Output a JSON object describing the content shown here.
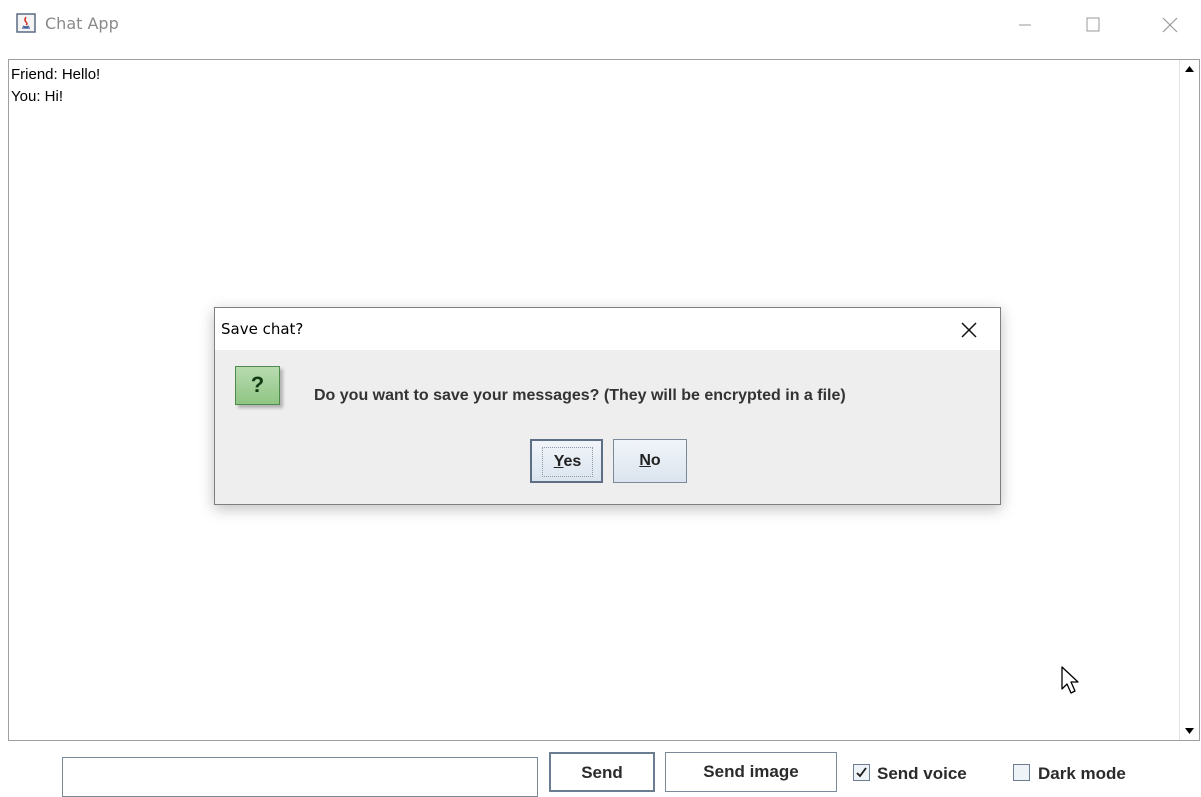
{
  "window": {
    "title": "Chat App",
    "icon": "java-app-icon"
  },
  "chat": {
    "lines": [
      "Friend: Hello!",
      "You: Hi!"
    ]
  },
  "controls": {
    "message_value": "",
    "send_label": "Send",
    "send_image_label": "Send image",
    "send_voice_label": "Send voice",
    "send_voice_checked": true,
    "dark_mode_label": "Dark mode",
    "dark_mode_checked": false
  },
  "dialog": {
    "title": "Save chat?",
    "message": "Do you want to save your messages? (They will be encrypted in a file)",
    "icon": "question-icon",
    "icon_glyph": "?",
    "yes_mnemonic": "Y",
    "yes_rest": "es",
    "no_mnemonic": "N",
    "no_rest": "o"
  },
  "colors": {
    "question_icon": "#8fc584",
    "dialog_background": "#eeeeee",
    "border": "#7a8a99"
  }
}
